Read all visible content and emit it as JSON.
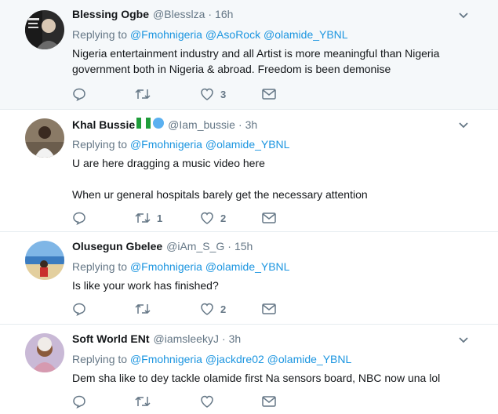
{
  "tweets": [
    {
      "name": "Blessing Ogbe",
      "handle": "@Blesslza",
      "time": "16h",
      "reply_prefix": "Replying to",
      "mentions": [
        "@Fmohnigeria",
        "@AsoRock",
        "@olamide_YBNL"
      ],
      "text_lines": [
        "Nigeria entertainment industry and all Artist is more meaningful than Nigeria",
        "government both in Nigeria & abroad. Freedom is been demonise"
      ],
      "retweets": "",
      "likes": "3",
      "avatar_icon": "person-photo-avatar"
    },
    {
      "name": "Khal Bussie",
      "handle": "@Iam_bussie",
      "time": "3h",
      "reply_prefix": "Replying to",
      "mentions": [
        "@Fmohnigeria",
        "@olamide_YBNL"
      ],
      "text_lines": [
        "U are here dragging a music video here",
        "",
        "When ur general hospitals barely get the necessary attention"
      ],
      "retweets": "1",
      "likes": "2",
      "avatar_icon": "person-photo-avatar"
    },
    {
      "name": "Olusegun Gbelee",
      "handle": "@iAm_S_G",
      "time": "15h",
      "reply_prefix": "Replying to",
      "mentions": [
        "@Fmohnigeria",
        "@olamide_YBNL"
      ],
      "text_lines": [
        "Is like your work has finished?"
      ],
      "retweets": "",
      "likes": "2",
      "avatar_icon": "beach-photo-avatar"
    },
    {
      "name": "Soft World ENt",
      "handle": "@iamsleekyJ",
      "time": "3h",
      "reply_prefix": "Replying to",
      "mentions": [
        "@Fmohnigeria",
        "@jackdre02",
        "@olamide_YBNL"
      ],
      "text_lines": [
        "Dem sha like to dey tackle olamide first Na sensors board, NBC now una lol"
      ],
      "retweets": "",
      "likes": "",
      "avatar_icon": "person-photo-avatar"
    }
  ],
  "colors": {
    "link": "#1b95e0",
    "muted": "#657786",
    "text": "#14171a",
    "highlight_bg": "#f5f8fa",
    "divider": "#e6ecf0"
  }
}
